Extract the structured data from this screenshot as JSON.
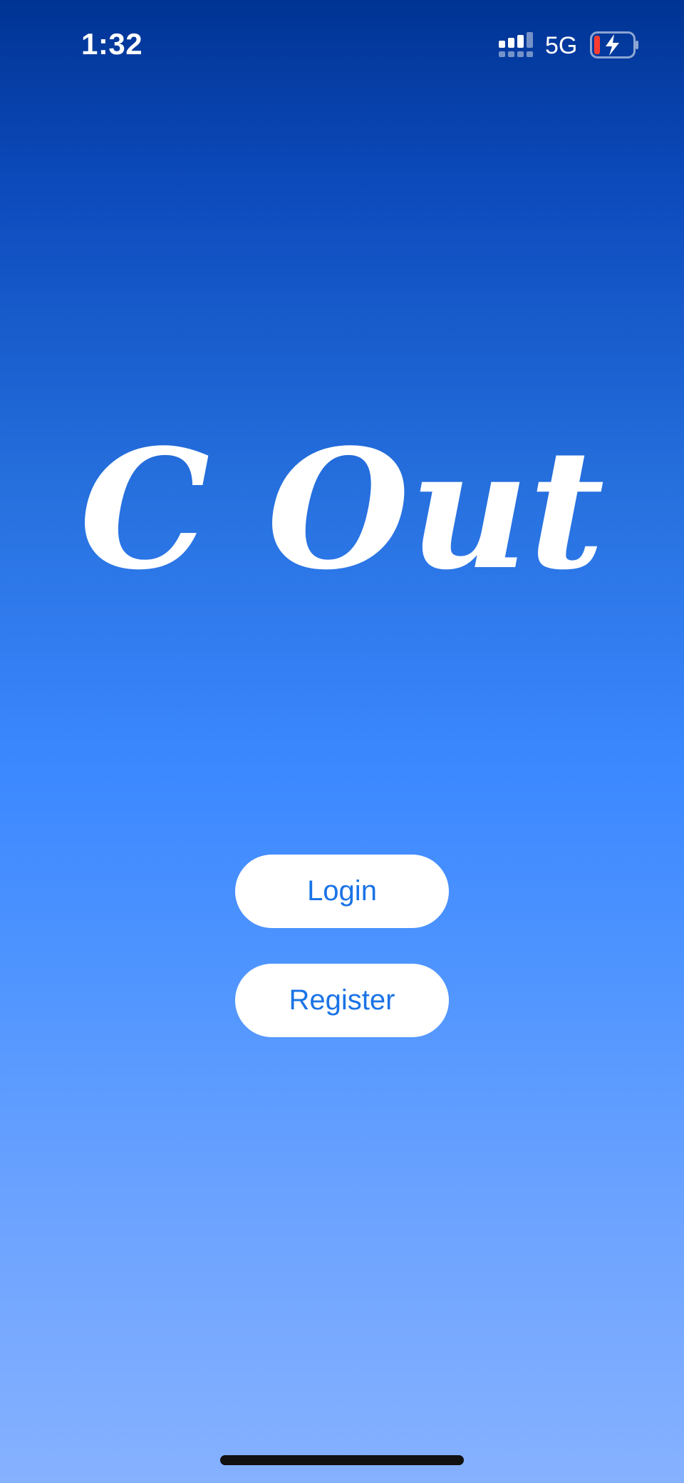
{
  "status_bar": {
    "time": "1:32",
    "network": "5G",
    "signal_icon": "cellular-signal-icon",
    "battery_icon": "battery-charging-low-icon"
  },
  "logo": {
    "text": "C Out"
  },
  "buttons": {
    "login": "Login",
    "register": "Register"
  },
  "colors": {
    "gradient_top": "#003494",
    "gradient_bottom": "#86b1ff",
    "button_text": "#1b73e6",
    "button_bg": "#ffffff",
    "battery_low": "#ff3b30"
  }
}
